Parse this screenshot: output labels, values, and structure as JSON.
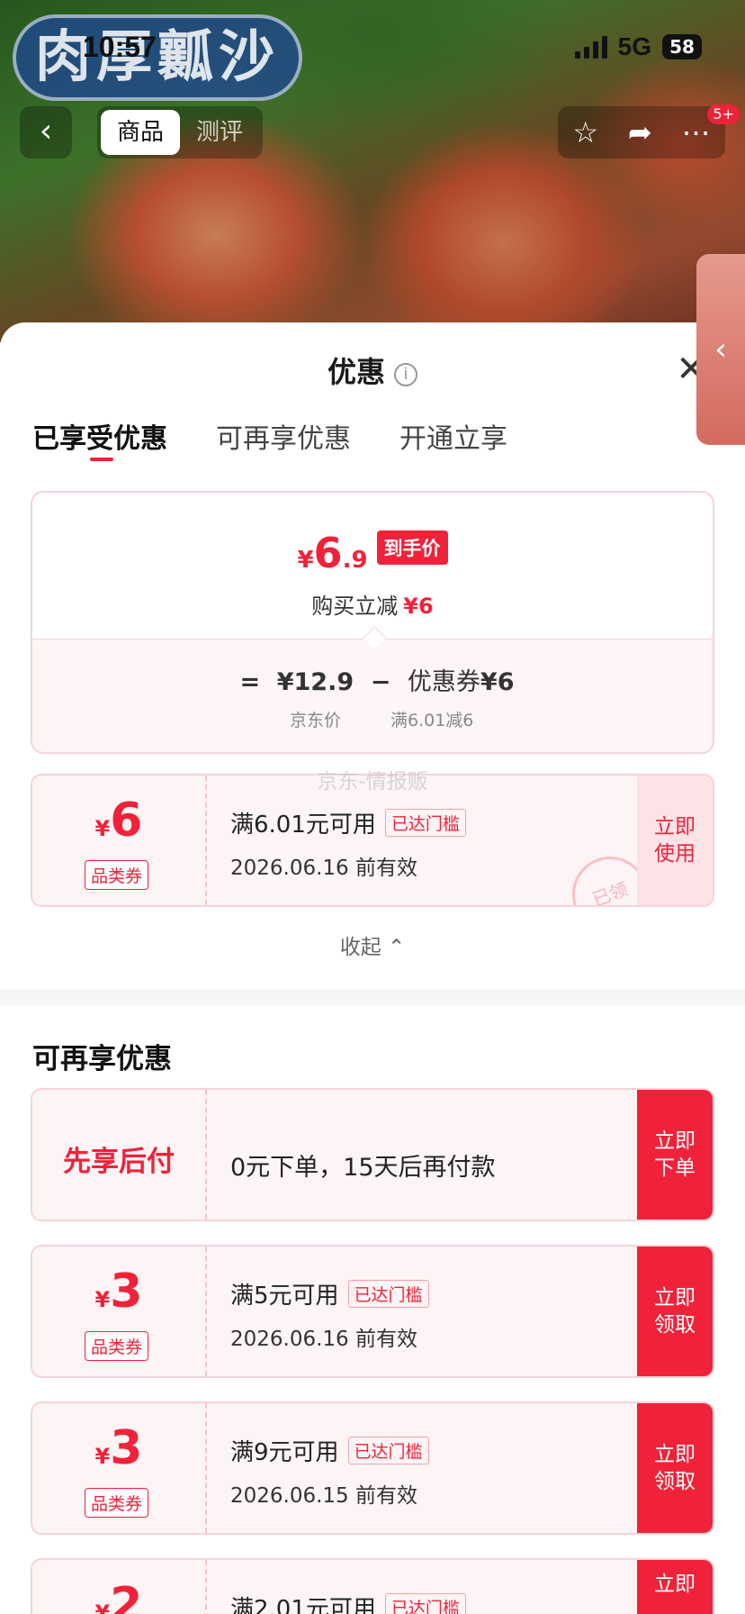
{
  "hero": {
    "logo_text": "肉厚瓤沙",
    "status_time": "10:57",
    "network": "5G",
    "battery": "58",
    "nav_tabs": [
      "商品",
      "测评"
    ],
    "badge": "5+"
  },
  "sheet": {
    "title": "优惠",
    "tabs": [
      "已享受优惠",
      "可再享优惠",
      "开通立享"
    ],
    "summary": {
      "price_yen": "¥",
      "price_int": "6",
      "price_dec": ".9",
      "price_tag": "到手价",
      "instant_label": "购买立减",
      "instant_amount": "¥6",
      "eq": "=",
      "jd_price": "¥12.9",
      "minus": "−",
      "coupon_label": "优惠券",
      "coupon_amount": "¥6",
      "jd_price_label": "京东价",
      "coupon_rule": "满6.01减6"
    },
    "watermark": "京东-情报贩",
    "applied_coupon": {
      "yen": "¥",
      "amount": "6",
      "type": "品类券",
      "title": "满6.01元可用",
      "threshold": "已达门槛",
      "date": "2026.06.16 前有效",
      "button": "立即使用",
      "stamp": "已领"
    },
    "collapse": "收起",
    "section_title": "可再享优惠",
    "offers": [
      {
        "left_text": "先享后付",
        "desc": "0元下单，15天后再付款",
        "button": "立即下单"
      },
      {
        "yen": "¥",
        "amount": "3",
        "type": "品类券",
        "title": "满5元可用",
        "threshold": "已达门槛",
        "date": "2026.06.16 前有效",
        "button": "立即领取"
      },
      {
        "yen": "¥",
        "amount": "3",
        "type": "品类券",
        "title": "满9元可用",
        "threshold": "已达门槛",
        "date": "2026.06.15 前有效",
        "button": "立即领取"
      },
      {
        "yen": "¥",
        "amount": "2",
        "title": "满2.01元可用",
        "threshold": "已达门槛",
        "button": "立即"
      }
    ]
  },
  "colors": {
    "accent": "#f0223a",
    "card_border": "#f6d3d8",
    "card_bg": "#fcf4f5"
  }
}
